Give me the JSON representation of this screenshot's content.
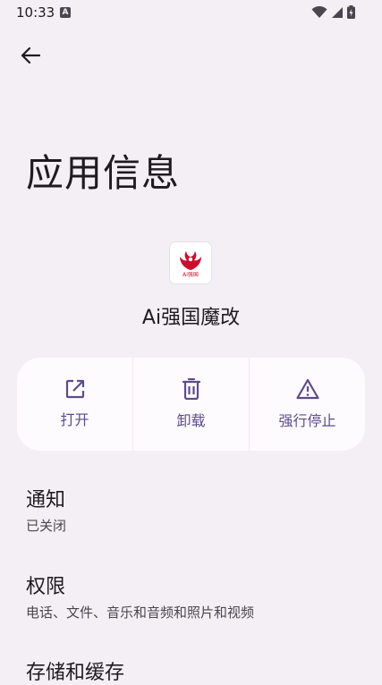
{
  "status_bar": {
    "time": "10:33",
    "badge": "A"
  },
  "header": {
    "title": "应用信息"
  },
  "app": {
    "name": "Ai强国魔改",
    "icon_text": "Ai强国"
  },
  "actions": [
    {
      "label": "打开",
      "icon": "open-external-icon"
    },
    {
      "label": "卸载",
      "icon": "trash-icon"
    },
    {
      "label": "强行停止",
      "icon": "warning-icon"
    }
  ],
  "settings": [
    {
      "title": "通知",
      "subtitle": "已关闭"
    },
    {
      "title": "权限",
      "subtitle": "电话、文件、音乐和音频和照片和视频"
    },
    {
      "title": "存储和缓存",
      "subtitle": ""
    }
  ],
  "colors": {
    "background": "#f3eff5",
    "accent": "#5b4d8a",
    "card": "#fdfbfe",
    "brand_red": "#c8102e"
  }
}
